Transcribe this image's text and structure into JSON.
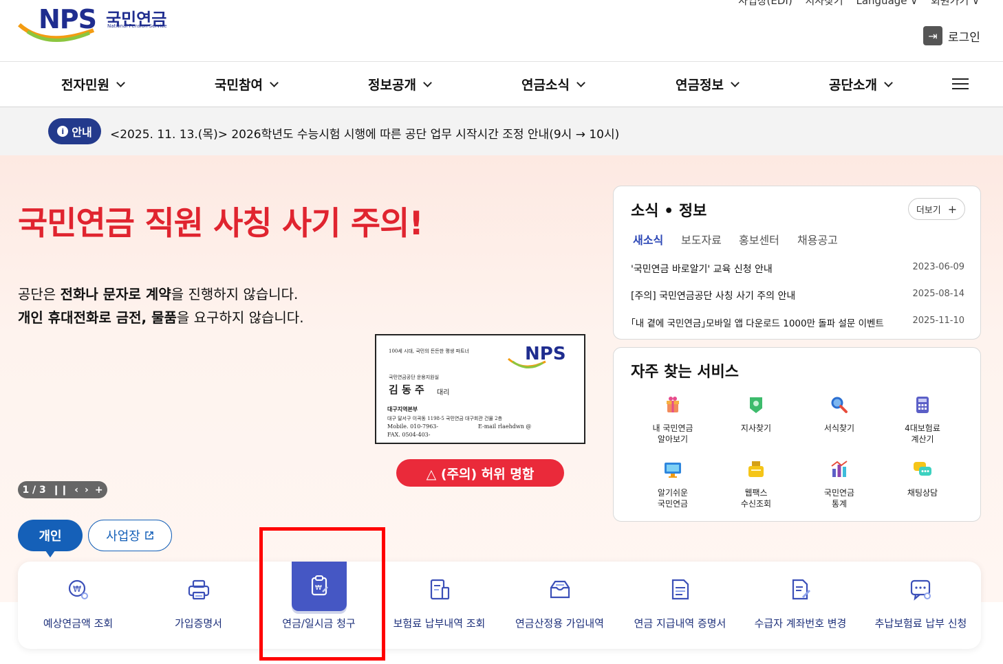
{
  "header": {
    "logo_mark": "NPS",
    "logo_kr": "국민연금",
    "logo_en": "National Pension Service",
    "util_links": [
      "사업장(EDI)",
      "지사찾기",
      "Language ∨",
      "회원가기 ∨"
    ],
    "login_label": "로그인"
  },
  "gnb": {
    "items": [
      {
        "label": "전자민원"
      },
      {
        "label": "국민참여"
      },
      {
        "label": "정보공개"
      },
      {
        "label": "연금소식"
      },
      {
        "label": "연금정보"
      },
      {
        "label": "공단소개"
      }
    ]
  },
  "notice": {
    "badge": "안내",
    "text": "<2025. 11. 13.(목)> 2026학년도 수능시험 시행에 따른 공단 업무 시작시간 조정 안내(9시 → 10시)"
  },
  "hero": {
    "title": "국민연금 직원 사칭 사기 주의!",
    "line1_a": "공단은 ",
    "line1_b": "전화나 문자로 계약",
    "line1_c": "을 진행하지 않습니다.",
    "line2_a": "개인 휴대전화로 금전, 물품",
    "line2_b": "을 요구하지 않습니다.",
    "card": {
      "slogan": "100세 시대, 국민의 든든한 평생 파트너",
      "brand": "NPS",
      "dept": "국민연금공단 운용지원실",
      "name": "김 동 주",
      "rank": "대리",
      "office": "대구지역본부",
      "address": "대구 달서구 이곡동 1198-5 국민연금 대구회관 건물 2층",
      "mobile": "Mobile. 010-7963-",
      "email": "E-mail rlaehdwn        @",
      "fax": "FAX. 0504-403-"
    },
    "warn_button": "△ (주의) 허위 명함",
    "pager": "1 / 3"
  },
  "user_tabs": {
    "personal": "개인",
    "business": "사업장"
  },
  "quick_menu": [
    {
      "label": "예상연금액 조회",
      "icon": "won-search-icon"
    },
    {
      "label": "가입증명서",
      "icon": "printer-icon"
    },
    {
      "label": "연금/일시금 청구",
      "icon": "clipboard-won-icon"
    },
    {
      "label": "보험료 납부내역 조회",
      "icon": "document-list-icon"
    },
    {
      "label": "연금산정용 가입내역",
      "icon": "box-icon"
    },
    {
      "label": "연금 지급내역 증명서",
      "icon": "certificate-icon"
    },
    {
      "label": "수급자 계좌번호 변경",
      "icon": "document-edit-icon"
    },
    {
      "label": "추납보험료 납부 신청",
      "icon": "chat-search-icon"
    }
  ],
  "news": {
    "title": "소식 • 정보",
    "more": "더보기",
    "tabs": [
      "새소식",
      "보도자료",
      "홍보센터",
      "채용공고"
    ],
    "items": [
      {
        "text": "'국민연금 바로알기' 교육 신청 안내",
        "date": "2023-06-09"
      },
      {
        "text": "[주의] 국민연금공단 사칭 사기 주의 안내",
        "date": "2025-08-14"
      },
      {
        "text": "｢내 곁에 국민연금｣모바일 앱 다운로드 1000만 돌파 설문 이벤트",
        "date": "2025-11-10"
      }
    ]
  },
  "services": {
    "title": "자주 찾는 서비스",
    "items": [
      {
        "line1": "내 국민연금",
        "line2": "알아보기",
        "icon": "gift-icon"
      },
      {
        "line1": "지사찾기",
        "line2": "",
        "icon": "map-pin-icon"
      },
      {
        "line1": "서식찾기",
        "line2": "",
        "icon": "magnifier-icon"
      },
      {
        "line1": "4대보험료",
        "line2": "계산기",
        "icon": "calculator-icon"
      },
      {
        "line1": "알기쉬운",
        "line2": "국민연금",
        "icon": "monitor-icon"
      },
      {
        "line1": "웹팩스",
        "line2": "수신조회",
        "icon": "fax-icon"
      },
      {
        "line1": "국민연금",
        "line2": "통계",
        "icon": "chart-icon"
      },
      {
        "line1": "채팅상담",
        "line2": "",
        "icon": "chat-icon"
      }
    ]
  },
  "colors": {
    "brand_navy": "#1f2d8f",
    "accent_blue": "#1560b8",
    "alert_red": "#e0242f",
    "highlight_frame": "#ff0000"
  }
}
